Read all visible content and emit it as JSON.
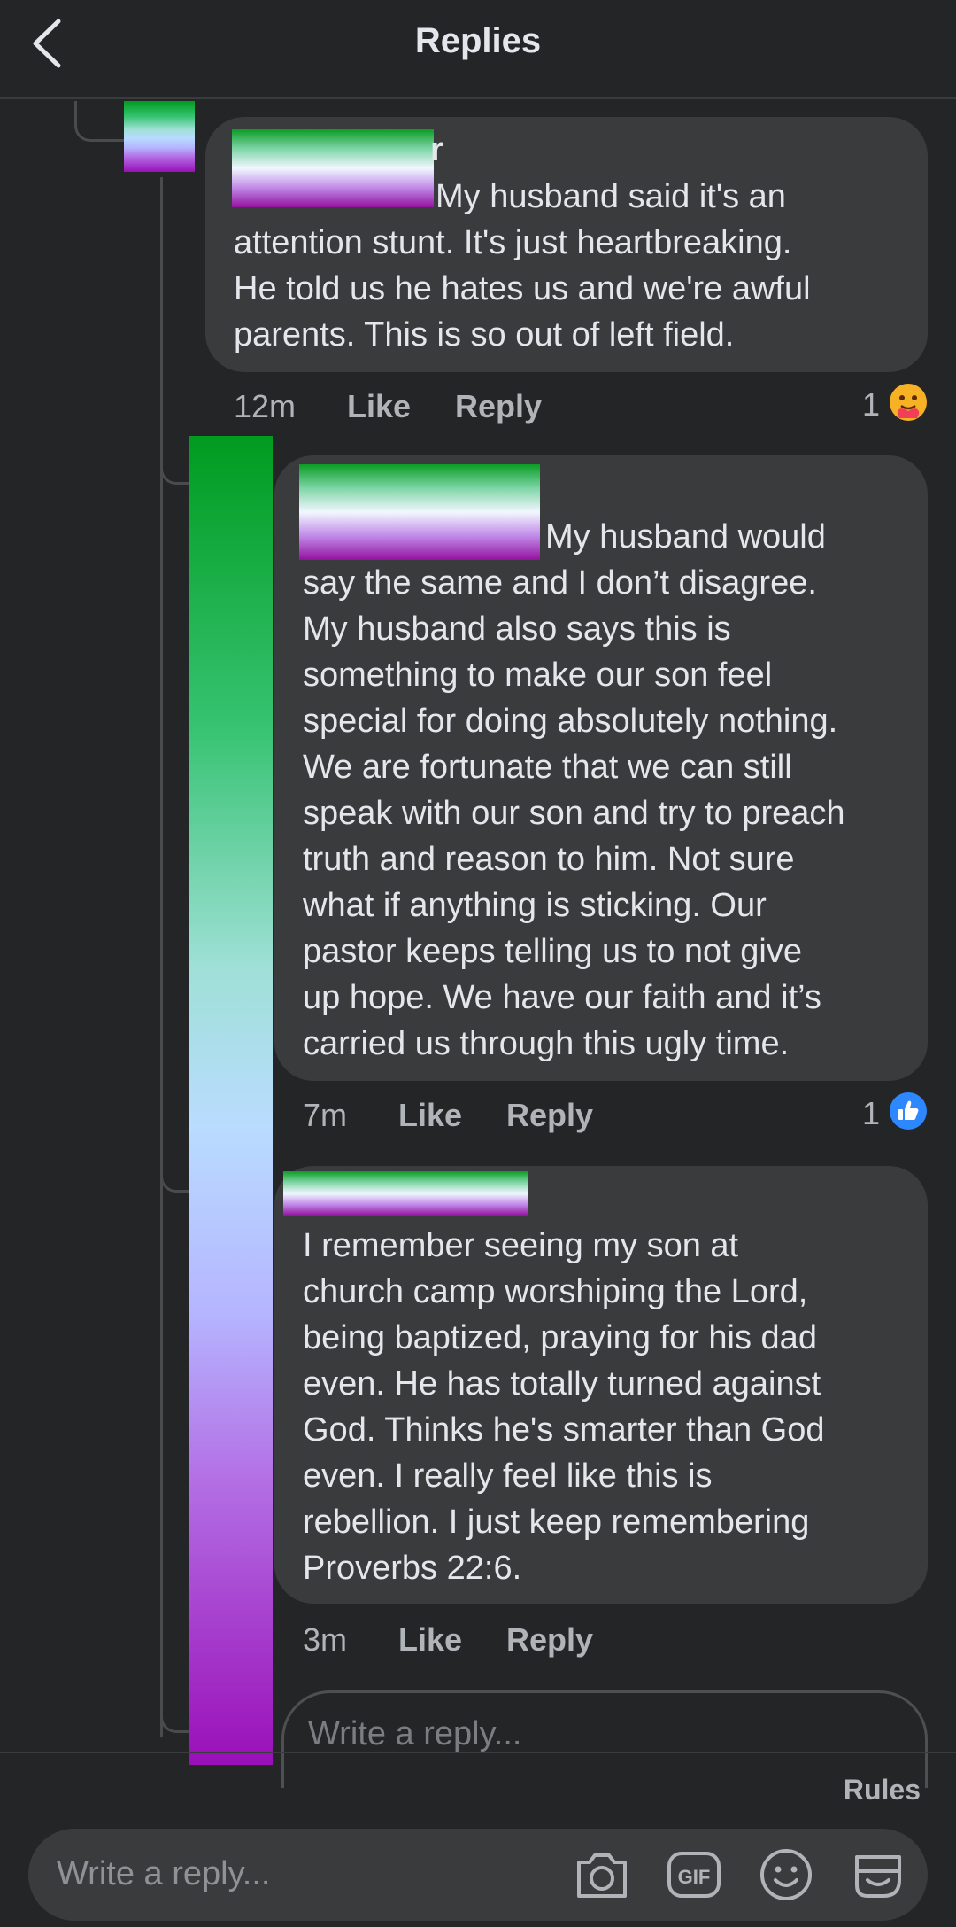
{
  "header": {
    "title": "Replies"
  },
  "comments": [
    {
      "name_fragment": "r",
      "text_lines": [
        "My husband said it's an",
        "attention stunt. It's just heartbreaking.",
        "He told us he hates us and we're awful",
        "parents.  This is so out of left field."
      ],
      "time": "12m",
      "like_label": "Like",
      "reply_label": "Reply",
      "reaction_count": "1",
      "reaction_icon": "care-reaction-icon"
    },
    {
      "text_lines": [
        "My husband would",
        "say the same and I don’t disagree.",
        "My husband also says this is",
        "something to make our son feel",
        "special for doing absolutely nothing.",
        "We are fortunate that we can still",
        "speak with our son and try to preach",
        "truth and reason to him. Not sure",
        "what if anything is sticking. Our",
        "pastor keeps telling us to not give",
        "up hope. We have our faith and it’s",
        "carried us through this ugly time."
      ],
      "time": "7m",
      "like_label": "Like",
      "reply_label": "Reply",
      "reaction_count": "1",
      "reaction_icon": "like-reaction-icon"
    },
    {
      "text_lines": [
        "I remember seeing my son at",
        "church camp worshiping the Lord,",
        "being baptized, praying for his dad",
        "even.  He has totally turned against",
        "God. Thinks he's smarter than God",
        "even.  I really feel like this is",
        "rebellion. I just keep remembering",
        "Proverbs 22:6."
      ],
      "time": "3m",
      "like_label": "Like",
      "reply_label": "Reply"
    }
  ],
  "inline_reply": {
    "placeholder": "Write a reply..."
  },
  "footer": {
    "rules_label": "Rules",
    "composer_placeholder": "Write a reply...",
    "icons": [
      "camera-icon",
      "gif-icon",
      "emoji-icon",
      "sticker-icon"
    ]
  },
  "colors": {
    "background": "#242526",
    "bubble": "#3a3b3c",
    "text": "#e4e6eb",
    "meta": "#b0b3b8",
    "like_blue": "#2d88ff"
  }
}
